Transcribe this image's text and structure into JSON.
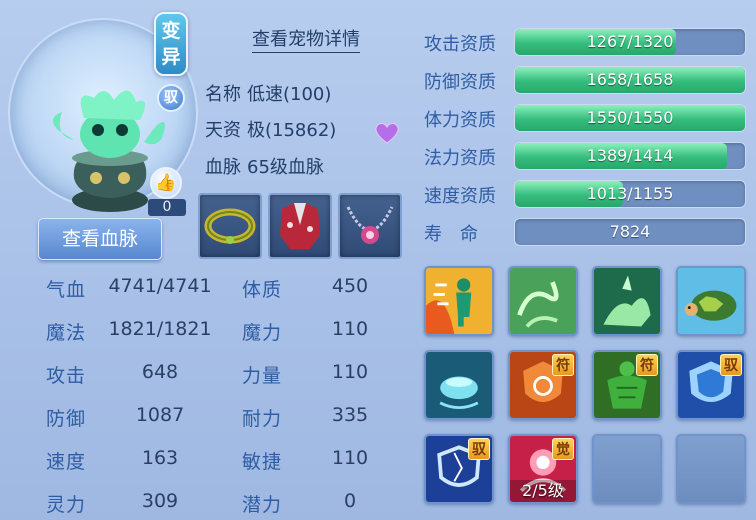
{
  "header": {
    "mutate_badge": "变异",
    "tame_badge": "驭",
    "like_icon": "thumbs-up-icon",
    "like_count": "0",
    "detail_link": "查看宠物详情",
    "blood_button": "查看血脉"
  },
  "info": {
    "name_label": "名称",
    "name_value": "低速(100)",
    "talent_label": "天资",
    "talent_value": "极(15862)",
    "blood_label": "血脉",
    "blood_value": "65级血脉"
  },
  "equipment": [
    {
      "icon": "bracelet-icon"
    },
    {
      "icon": "armor-icon"
    },
    {
      "icon": "necklace-icon"
    }
  ],
  "stats": [
    {
      "label": "气血",
      "value": "4741/4741",
      "label2": "体质",
      "value2": "450"
    },
    {
      "label": "魔法",
      "value": "1821/1821",
      "label2": "魔力",
      "value2": "110"
    },
    {
      "label": "攻击",
      "value": "648",
      "label2": "力量",
      "value2": "110"
    },
    {
      "label": "防御",
      "value": "1087",
      "label2": "耐力",
      "value2": "335"
    },
    {
      "label": "速度",
      "value": "163",
      "label2": "敏捷",
      "value2": "110"
    },
    {
      "label": "灵力",
      "value": "309",
      "label2": "潜力",
      "value2": "0"
    }
  ],
  "aptitudes": [
    {
      "label": "攻击资质",
      "text": "1267/1320",
      "fraction": 0.7
    },
    {
      "label": "防御资质",
      "text": "1658/1658",
      "fraction": 1.0
    },
    {
      "label": "体力资质",
      "text": "1550/1550",
      "fraction": 1.0
    },
    {
      "label": "法力资质",
      "text": "1389/1414",
      "fraction": 0.92
    },
    {
      "label": "速度资质",
      "text": "1013/1155",
      "fraction": 0.47
    },
    {
      "label": "寿　命",
      "text": "7824",
      "fraction": 0
    }
  ],
  "skills": [
    {
      "icon": "speed-runner-icon"
    },
    {
      "icon": "wind-swirl-icon"
    },
    {
      "icon": "green-beast-icon"
    },
    {
      "icon": "turtle-icon"
    },
    {
      "icon": "cauldron-icon"
    },
    {
      "icon": "shield-spin-icon",
      "tag": "符"
    },
    {
      "icon": "muscle-man-icon",
      "tag": "符"
    },
    {
      "icon": "blue-shield-icon",
      "tag": "驭"
    },
    {
      "icon": "broken-shield-icon",
      "tag": "驭"
    },
    {
      "icon": "awaken-icon",
      "tag": "觉",
      "level": "2/5级"
    },
    {
      "icon": "empty-slot-icon"
    },
    {
      "icon": "empty-slot-icon"
    }
  ],
  "colors": {
    "bar_fill": "#35bd7e",
    "bar_track": "#6f8fc0",
    "label_blue": "#2f5da3"
  }
}
